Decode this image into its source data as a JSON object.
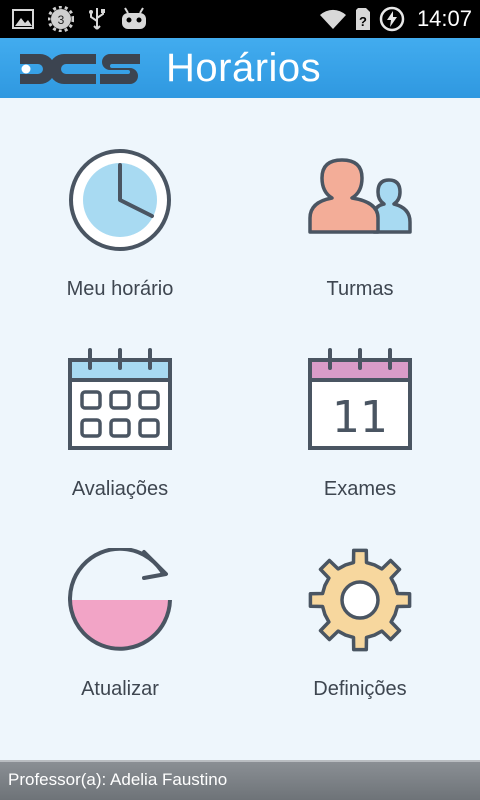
{
  "status_bar": {
    "time": "14:07",
    "icons": [
      "image-icon",
      "settings-badge-icon",
      "usb-icon",
      "android-icon",
      "wifi-icon",
      "no-sim-icon",
      "battery-charging-icon"
    ],
    "badge_count": "3"
  },
  "header": {
    "logo_text": "DCS",
    "title": "Horários",
    "color": "#3aa4ea"
  },
  "menu": {
    "items": [
      {
        "label": "Meu horário",
        "icon": "clock-icon"
      },
      {
        "label": "Turmas",
        "icon": "people-icon"
      },
      {
        "label": "Avaliações",
        "icon": "calendar-grid-icon"
      },
      {
        "label": "Exames",
        "icon": "calendar-day-icon"
      },
      {
        "label": "Atualizar",
        "icon": "refresh-icon"
      },
      {
        "label": "Definições",
        "icon": "gear-icon"
      }
    ],
    "calendar_day": "11"
  },
  "footer": {
    "text": "Professor(a): Adelia Faustino"
  }
}
